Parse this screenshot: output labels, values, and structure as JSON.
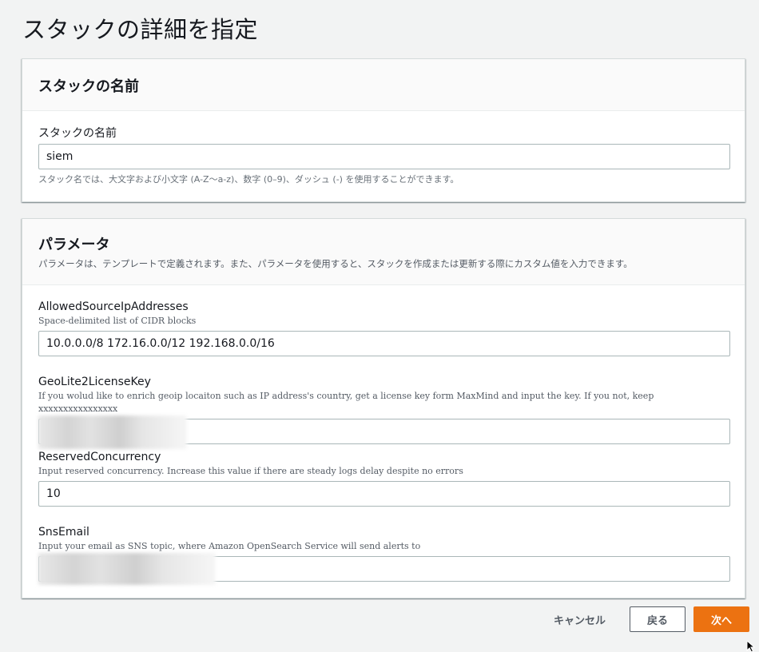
{
  "page": {
    "title": "スタックの詳細を指定"
  },
  "stack_name_panel": {
    "title": "スタックの名前",
    "field_label": "スタックの名前",
    "value": "siem",
    "constraint": "スタック名では、大文字および小文字 (A-Z〜a-z)、数字 (0–9)、ダッシュ (-) を使用することができます。"
  },
  "params_panel": {
    "title": "パラメータ",
    "description": "パラメータは、テンプレートで定義されます。また、パラメータを使用すると、スタックを作成または更新する際にカスタム値を入力できます。",
    "params": [
      {
        "label": "AllowedSourceIpAddresses",
        "description": "Space-delimited list of CIDR blocks",
        "value": "10.0.0.0/8 172.16.0.0/12 192.168.0.0/16"
      },
      {
        "label": "GeoLite2LicenseKey",
        "description": "If you wolud like to enrich geoip locaiton such as IP address's country, get a license key form MaxMind and input the key. If you not, keep xxxxxxxxxxxxxxxx",
        "value": ""
      },
      {
        "label": "ReservedConcurrency",
        "description": "Input reserved concurrency. Increase this value if there are steady logs delay despite no errors",
        "value": "10"
      },
      {
        "label": "SnsEmail",
        "description": "Input your email as SNS topic, where Amazon OpenSearch Service will send alerts to",
        "value": ""
      }
    ]
  },
  "actions": {
    "cancel": "キャンセル",
    "back": "戻る",
    "next": "次へ"
  },
  "colors": {
    "primary": "#ec7211",
    "background": "#f2f3f3"
  }
}
